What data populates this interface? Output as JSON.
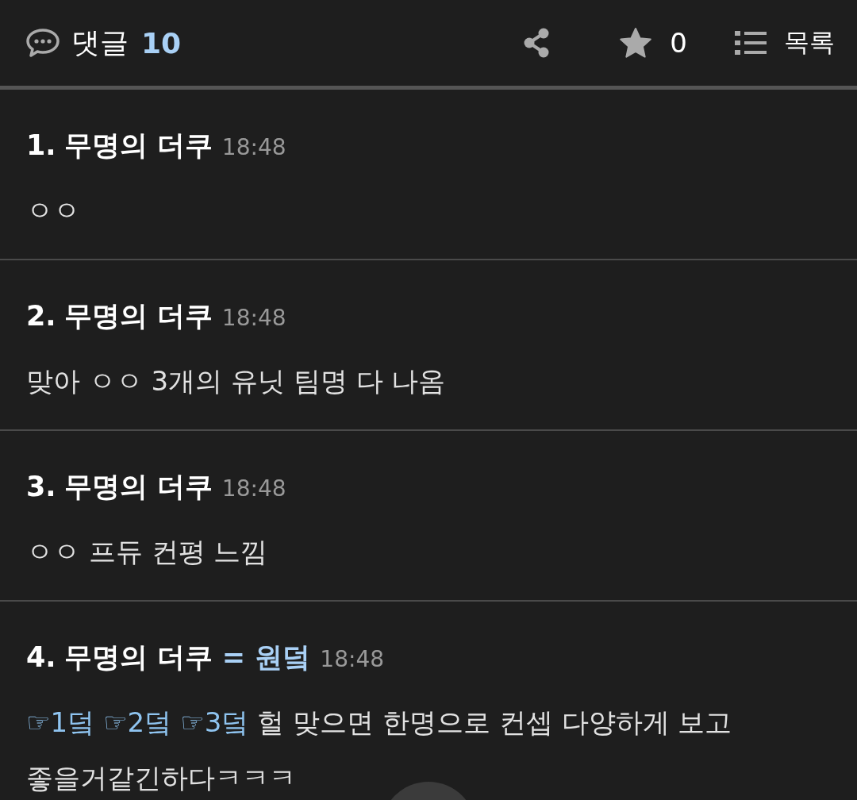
{
  "header": {
    "title": "댓글",
    "count": "10",
    "star_count": "0",
    "list_label": "목록"
  },
  "comments": [
    {
      "number": "1.",
      "author": "무명의 더쿠",
      "time": "18:48",
      "body": [
        {
          "kind": "text",
          "text": "ㅇㅇ"
        }
      ]
    },
    {
      "number": "2.",
      "author": "무명의 더쿠",
      "time": "18:48",
      "body": [
        {
          "kind": "text",
          "text": "맞아 ㅇㅇ 3개의 유닛 팀명 다 나옴"
        }
      ]
    },
    {
      "number": "3.",
      "author": "무명의 더쿠",
      "time": "18:48",
      "body": [
        {
          "kind": "text",
          "text": "ㅇㅇ 프듀 컨평 느낌"
        }
      ]
    },
    {
      "number": "4.",
      "author": "무명의 더쿠",
      "tag": "= 원덬",
      "time": "18:48",
      "body": [
        {
          "kind": "link",
          "text": "☞1덬"
        },
        {
          "kind": "link",
          "text": "☞2덬"
        },
        {
          "kind": "link",
          "text": "☞3덬"
        },
        {
          "kind": "text",
          "text": "헐 맞으면 한명으로 컨셉 다양하게 보고"
        },
        {
          "kind": "break"
        },
        {
          "kind": "text",
          "text": "좋을거같긴하다ㅋㅋㅋ"
        }
      ]
    }
  ]
}
